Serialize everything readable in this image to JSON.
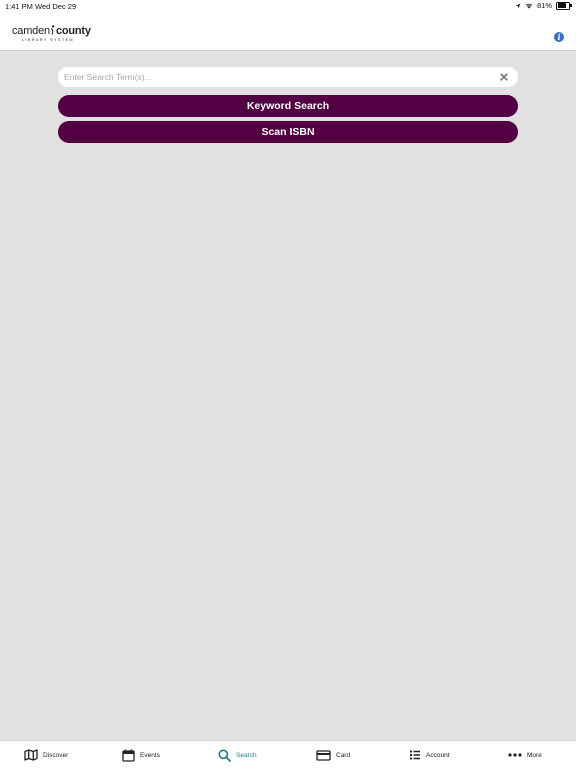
{
  "status_bar": {
    "time": "1:41 PM",
    "date": "Wed Dec 29",
    "battery": "81%",
    "battery_level": 0.81
  },
  "header": {
    "logo_main_part1": "camden",
    "logo_main_part2": "county",
    "logo_sub": "LIBRARY SYSTEM",
    "info_icon": "info-icon"
  },
  "search": {
    "placeholder": "Enter Search Term(s)...",
    "value": "",
    "clear_icon": "close-icon"
  },
  "buttons": {
    "keyword_search": "Keyword Search",
    "scan_isbn": "Scan ISBN"
  },
  "tabs": [
    {
      "label": "Discover",
      "icon": "map-icon"
    },
    {
      "label": "Events",
      "icon": "calendar-icon"
    },
    {
      "label": "Search",
      "icon": "search-icon",
      "active": true
    },
    {
      "label": "Card",
      "icon": "card-icon"
    },
    {
      "label": "Account",
      "icon": "list-icon"
    },
    {
      "label": "More",
      "icon": "more-icon"
    }
  ],
  "colors": {
    "accent": "#520043",
    "active_tab": "#1e7b86",
    "background": "#e1e1e1",
    "info": "#3a6fc4"
  }
}
